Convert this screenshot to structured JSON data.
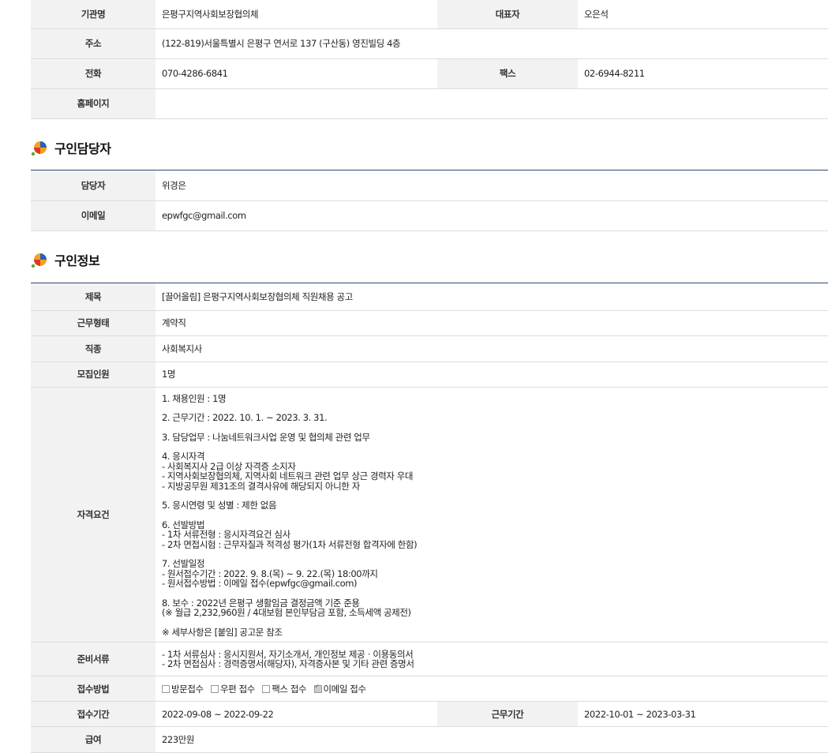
{
  "org": {
    "name_label": "기관명",
    "name": "은평구지역사회보장협의체",
    "rep_label": "대표자",
    "rep": "오은석",
    "addr_label": "주소",
    "addr": "(122-819)서울특별시 은평구 연서로 137 (구산동) 영진빌딩 4층",
    "tel_label": "전화",
    "tel": "070-4286-6841",
    "fax_label": "팩스",
    "fax": "02-6944-8211",
    "home_label": "홈페이지",
    "home": ""
  },
  "contact": {
    "title": "구인담당자",
    "person_label": "담당자",
    "person": "위경은",
    "email_label": "이메일",
    "email": "epwfgc@gmail.com"
  },
  "job": {
    "title": "구인정보",
    "subject_label": "제목",
    "subject": "[끌어올림] 은평구지역사회보장협의체 직원채용 공고",
    "type_label": "근무형태",
    "type": "계약직",
    "field_label": "직종",
    "field": "사회복지사",
    "count_label": "모집인원",
    "count": "1명",
    "req_label": "자격요건",
    "req": [
      [
        "1. 채용인원 : 1명"
      ],
      [
        "2. 근무기간 : 2022. 10. 1. ~ 2023. 3. 31."
      ],
      [
        "3. 담당업무 : 나눔네트워크사업 운영 및 협의체 관련 업무"
      ],
      [
        "4. 응시자격",
        "- 사회복지사 2급 이상 자격증 소지자",
        "- 지역사회보장협의체, 지역사회 네트워크 관련 업무 상근 경력자 우대",
        "- 지방공무원 제31조의 결격사유에 해당되지 아니한 자"
      ],
      [
        "5. 응시연령 및 성별 : 제한 없음"
      ],
      [
        "6. 선발방법",
        "- 1차 서류전형 : 응시자격요건 심사",
        "- 2차 면접시험 : 근무자질과 적격성 평가(1차 서류전형 합격자에 한함)"
      ],
      [
        "7. 선발일정",
        "- 원서접수기간 : 2022. 9. 8.(목) ~ 9. 22.(목) 18:00까지",
        "- 원서접수방법 : 이메일 접수(epwfgc@gmail.com)"
      ],
      [
        "8. 보수 : 2022년 은평구 생활임금 결정금액 기준 준용",
        " (※ 월급 2,232,960원 / 4대보험 본인부담금 포함, 소득세액 공제전)"
      ],
      [
        "※ 세부사항은 [붙임] 공고문 참조"
      ]
    ],
    "docs_label": "준비서류",
    "docs": [
      "- 1차 서류심사 : 응시지원서, 자기소개서, 개인정보 제공ㆍ이용동의서",
      "- 2차 면접심사 : 경력증명서(해당자), 자격증사본 및 기타 관련 증명서"
    ],
    "method_label": "접수방법",
    "methods": [
      {
        "label": "방문접수",
        "checked": false
      },
      {
        "label": "우편 접수",
        "checked": false
      },
      {
        "label": "팩스 접수",
        "checked": false
      },
      {
        "label": "이메일 접수",
        "checked": true
      }
    ],
    "period_label": "접수기간",
    "period": "2022-09-08 ~ 2022-09-22",
    "work_label": "근무기간",
    "work": "2022-10-01 ~ 2023-03-31",
    "pay_label": "급여",
    "pay": "223만원"
  },
  "colors": {
    "accent_line": "#2e4a6e",
    "header_bg": "#f2f2f2"
  },
  "icons": {
    "section": "colorful-leaf-logo-icon"
  }
}
